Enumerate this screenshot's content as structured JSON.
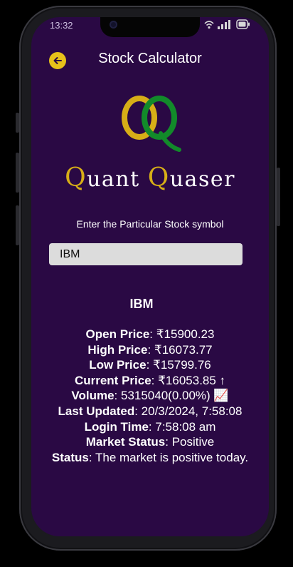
{
  "status_bar": {
    "time": "13:32"
  },
  "header": {
    "title": "Stock Calculator"
  },
  "brand": {
    "first_initial": "Q",
    "first_rest": "uant",
    "second_initial": "Q",
    "second_rest": "uaser"
  },
  "form": {
    "prompt": "Enter the  Particular Stock symbol",
    "symbol_value": "IBM"
  },
  "result": {
    "symbol": "IBM",
    "open_label": "Open Price",
    "open_value": ": ₹15900.23",
    "high_label": "High Price",
    "high_value": ": ₹16073.77",
    "low_label": "Low Price",
    "low_value": ": ₹15799.76",
    "current_label": "Current Price",
    "current_value": ": ₹16053.85 ↑",
    "volume_label": "Volume",
    "volume_value": ": 5315040(0.00%) 📈",
    "updated_label": "Last Updated",
    "updated_value": ": 20/3/2024, 7:58:08",
    "login_label": "Login Time",
    "login_value": ": 7:58:08 am",
    "market_label": "Market Status",
    "market_value": ": Positive",
    "status_label": "Status",
    "status_value": ": The market is positive today."
  },
  "icons": {
    "back": "arrow-left-icon",
    "wifi": "wifi-icon",
    "signal": "signal-icon",
    "battery": "battery-icon"
  },
  "colors": {
    "screen_bg": "#2a0944",
    "accent_gold": "#d7ae17",
    "logo_green": "#128a2a",
    "input_bg": "#dcdcdc"
  }
}
